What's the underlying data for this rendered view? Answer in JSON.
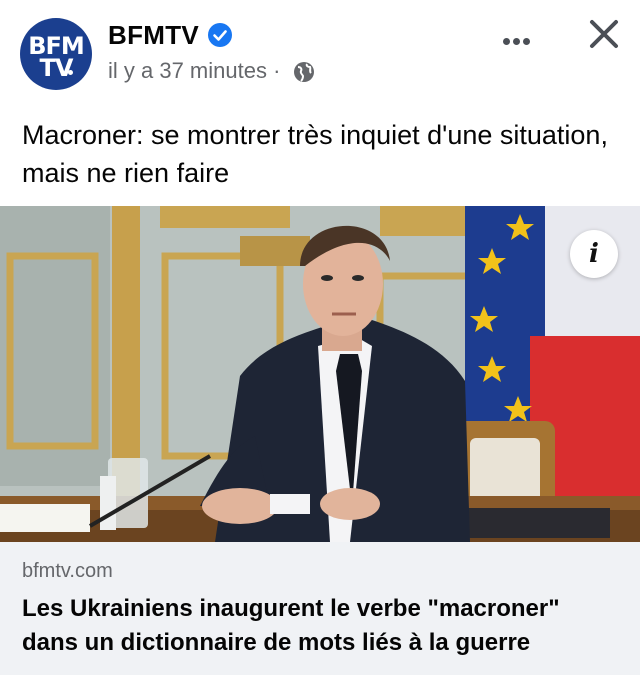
{
  "post": {
    "page_name": "BFMTV",
    "verified_icon": "verified-badge-icon",
    "timestamp": "il y a 37 minutes",
    "separator": "·",
    "privacy_icon": "globe-icon",
    "text": "Macroner:  se montrer très inquiet d'une situation, mais ne rien faire",
    "avatar": {
      "line1": "BFM",
      "line2": "TV"
    }
  },
  "link_preview": {
    "domain": "bfmtv.com",
    "headline": "Les Ukrainiens inaugurent le verbe \"macroner\" dans un dictionnaire de mots liés à la guerre"
  },
  "colors": {
    "brand_blue": "#1b3f8f",
    "verified_blue": "#1877f2",
    "meta_gray": "#65676b",
    "card_bg": "#f0f2f5"
  },
  "icons": [
    "more-options-icon",
    "close-icon",
    "info-icon"
  ],
  "info_label": "i"
}
